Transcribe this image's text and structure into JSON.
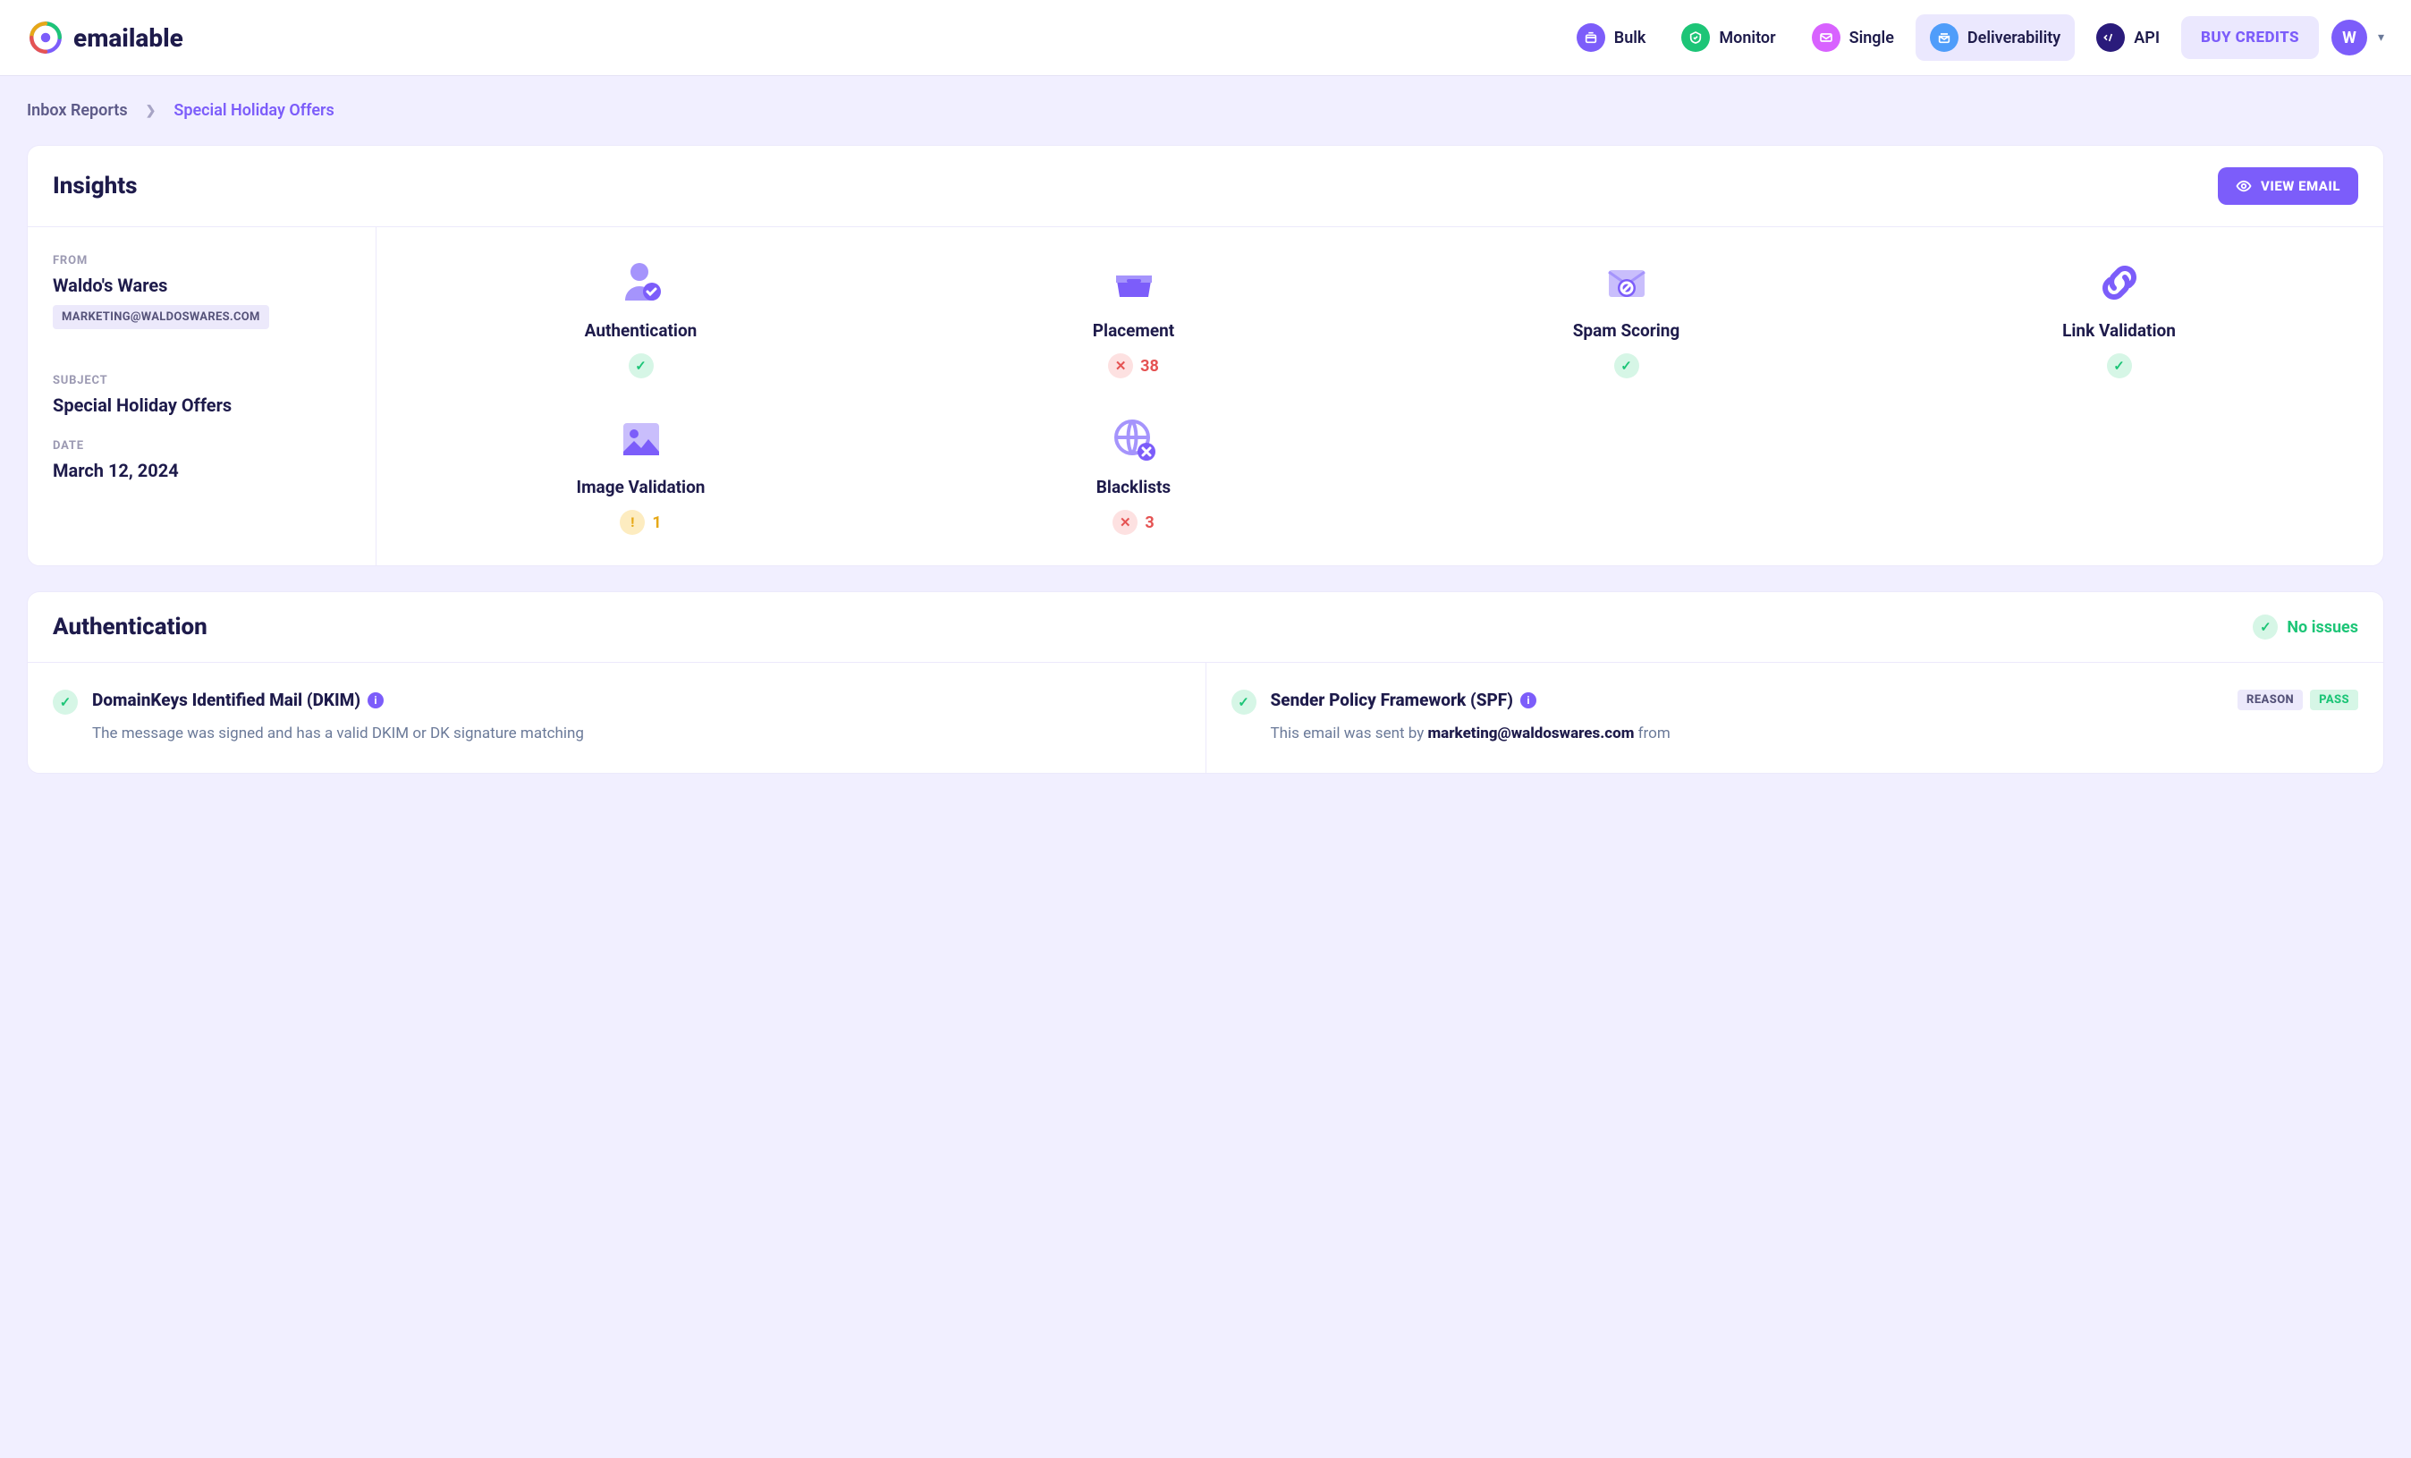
{
  "brand": "emailable",
  "nav": {
    "bulk": "Bulk",
    "monitor": "Monitor",
    "single": "Single",
    "deliverability": "Deliverability",
    "api": "API"
  },
  "buy_credits": "BUY CREDITS",
  "avatar_initial": "W",
  "breadcrumb": {
    "root": "Inbox Reports",
    "current": "Special Holiday Offers"
  },
  "insights": {
    "title": "Insights",
    "view_email": "VIEW EMAIL",
    "from_label": "FROM",
    "from_name": "Waldo's Wares",
    "from_email": "MARKETING@WALDOSWARES.COM",
    "subject_label": "SUBJECT",
    "subject": "Special Holiday Offers",
    "date_label": "DATE",
    "date": "March 12, 2024",
    "tiles": {
      "authentication": {
        "label": "Authentication"
      },
      "placement": {
        "label": "Placement",
        "count": "38"
      },
      "spam": {
        "label": "Spam Scoring"
      },
      "link": {
        "label": "Link Validation"
      },
      "image": {
        "label": "Image Validation",
        "count": "1"
      },
      "blacklists": {
        "label": "Blacklists",
        "count": "3"
      }
    }
  },
  "auth": {
    "title": "Authentication",
    "no_issues": "No issues",
    "dkim_title": "DomainKeys Identified Mail (DKIM)",
    "dkim_desc": "The message was signed and has a valid DKIM or DK signature matching",
    "spf_title": "Sender Policy Framework (SPF)",
    "spf_desc_pre": "This email was sent by ",
    "spf_desc_email": "marketing@waldoswares.com",
    "spf_desc_post": " from",
    "reason": "REASON",
    "pass": "PASS"
  }
}
